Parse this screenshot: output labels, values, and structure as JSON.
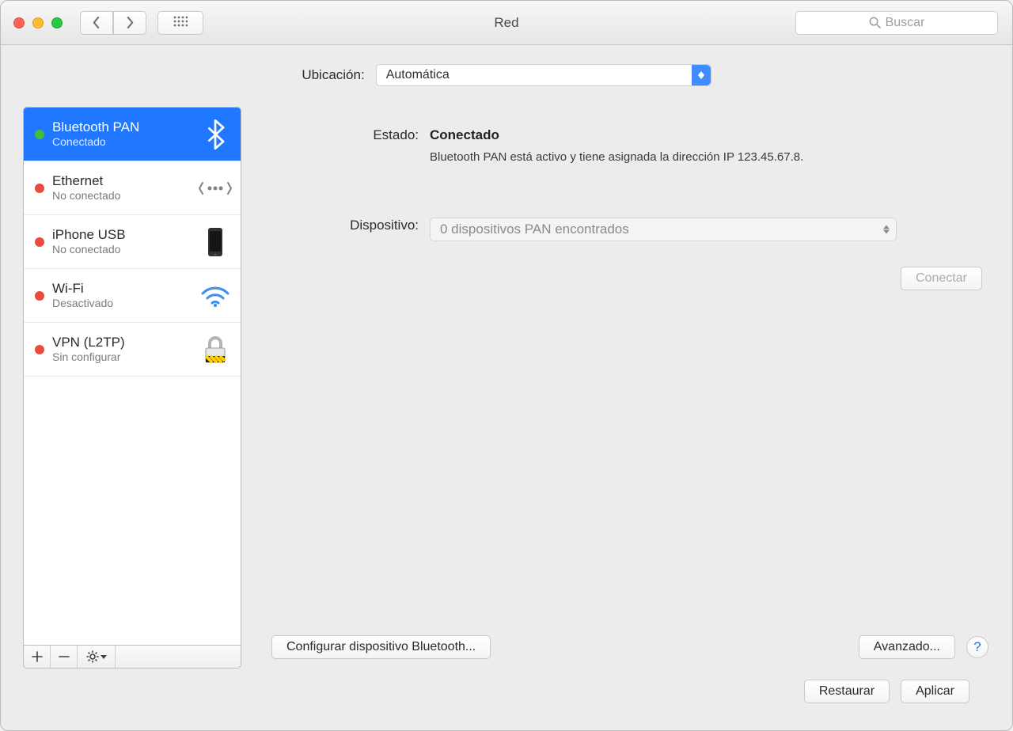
{
  "window": {
    "title": "Red",
    "search_placeholder": "Buscar"
  },
  "location": {
    "label": "Ubicación:",
    "value": "Automática"
  },
  "interfaces": [
    {
      "name": "Bluetooth PAN",
      "status": "Conectado",
      "dot": "green",
      "icon": "bluetooth",
      "selected": true
    },
    {
      "name": "Ethernet",
      "status": "No conectado",
      "dot": "red",
      "icon": "ethernet",
      "selected": false
    },
    {
      "name": "iPhone USB",
      "status": "No conectado",
      "dot": "red",
      "icon": "iphone",
      "selected": false
    },
    {
      "name": "Wi-Fi",
      "status": "Desactivado",
      "dot": "red",
      "icon": "wifi",
      "selected": false
    },
    {
      "name": "VPN (L2TP)",
      "status": "Sin configurar",
      "dot": "red",
      "icon": "lock",
      "selected": false
    }
  ],
  "details": {
    "status_label": "Estado:",
    "status_value": "Conectado",
    "status_desc": "Bluetooth PAN está activo y tiene asignada la dirección IP 123.45.67.8.",
    "device_label": "Dispositivo:",
    "device_value": "0 dispositivos PAN encontrados",
    "connect_button": "Conectar",
    "configure_button": "Configurar dispositivo Bluetooth...",
    "advanced_button": "Avanzado...",
    "help": "?"
  },
  "footer": {
    "revert": "Restaurar",
    "apply": "Aplicar"
  }
}
